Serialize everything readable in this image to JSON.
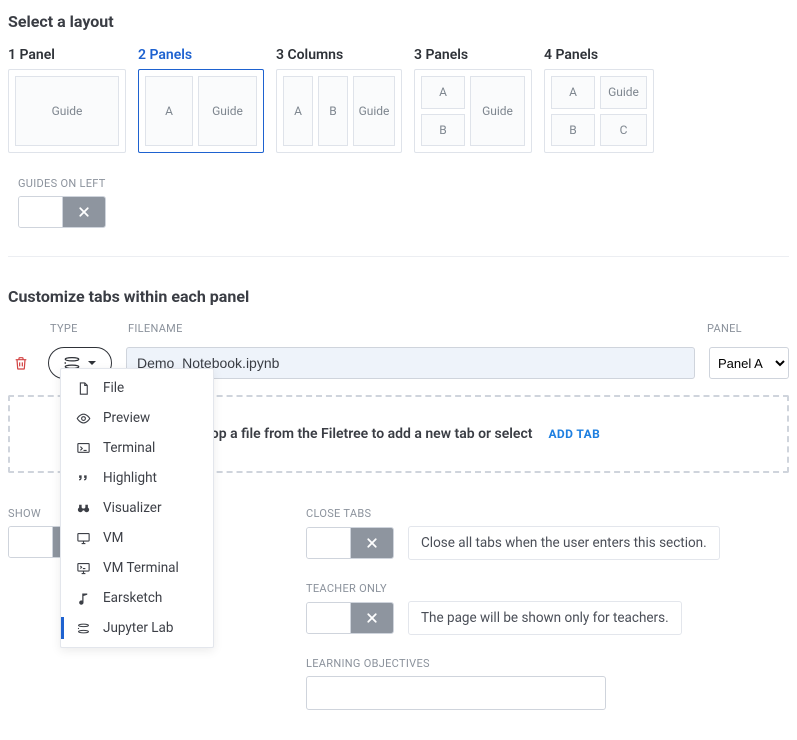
{
  "section_layout_title": "Select a layout",
  "layouts": {
    "l1": {
      "label": "1 Panel",
      "guide": "Guide"
    },
    "l2": {
      "label": "2 Panels",
      "a": "A",
      "guide": "Guide"
    },
    "l3": {
      "label": "3 Columns",
      "a": "A",
      "b": "B",
      "guide": "Guide"
    },
    "l4": {
      "label": "3 Panels",
      "a": "A",
      "b": "B",
      "guide": "Guide"
    },
    "l5": {
      "label": "4 Panels",
      "a": "A",
      "b": "B",
      "c": "C",
      "guide": "Guide"
    }
  },
  "guides_on_left_label": "GUIDES ON LEFT",
  "section_customize_title": "Customize tabs within each panel",
  "columns": {
    "type": "TYPE",
    "filename": "FILENAME",
    "panel": "PANEL"
  },
  "tab_row": {
    "filename": "Demo_Notebook.ipynb",
    "panel_value": "Panel A"
  },
  "dropzone_text": "Drop a file from the Filetree to add a new tab or select",
  "add_tab_label": "ADD TAB",
  "type_menu": {
    "file": "File",
    "preview": "Preview",
    "terminal": "Terminal",
    "highlight": "Highlight",
    "visualizer": "Visualizer",
    "vm": "VM",
    "vmterm": "VM Terminal",
    "earsketch": "Earsketch",
    "jupyter": "Jupyter Lab"
  },
  "show_folder_label": "SHOW",
  "close_tabs": {
    "label": "CLOSE TABS",
    "desc": "Close all tabs when the user enters this section."
  },
  "teacher_only": {
    "label": "TEACHER ONLY",
    "desc": "The page will be shown only for teachers."
  },
  "learning_objectives_label": "LEARNING OBJECTIVES"
}
